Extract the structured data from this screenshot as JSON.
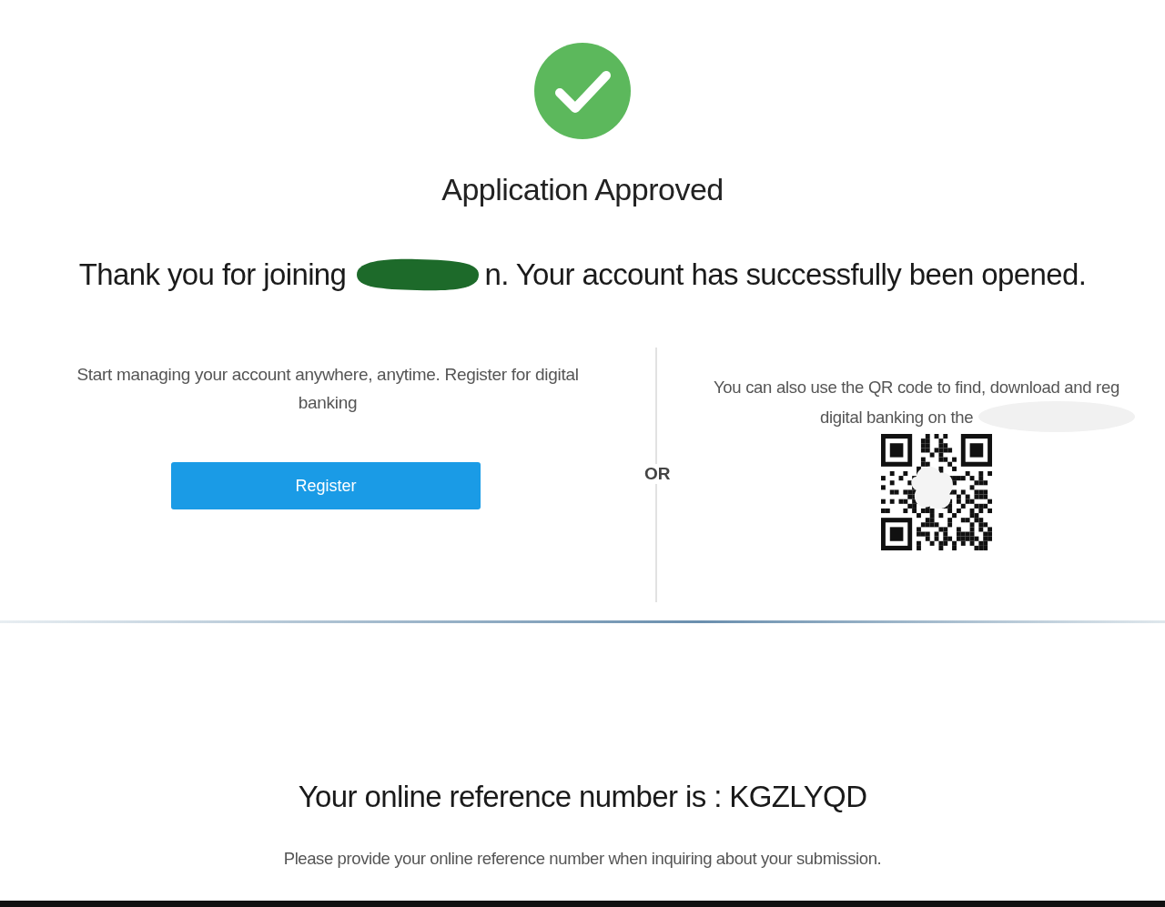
{
  "header": {
    "title": "Application Approved"
  },
  "message": {
    "before": "Thank you for joining",
    "after": "n. Your account has successfully been opened."
  },
  "register_panel": {
    "text": "Start managing your account anywhere, anytime. Register for digital banking",
    "button": "Register"
  },
  "separator": "OR",
  "qr_panel": {
    "lines": [
      "You can also use the QR code to find, download and reg",
      "digital banking on the"
    ]
  },
  "reference": {
    "text": "Your online reference number is : KGZLYQD",
    "note": "Please provide your online reference number when inquiring about your submission."
  }
}
